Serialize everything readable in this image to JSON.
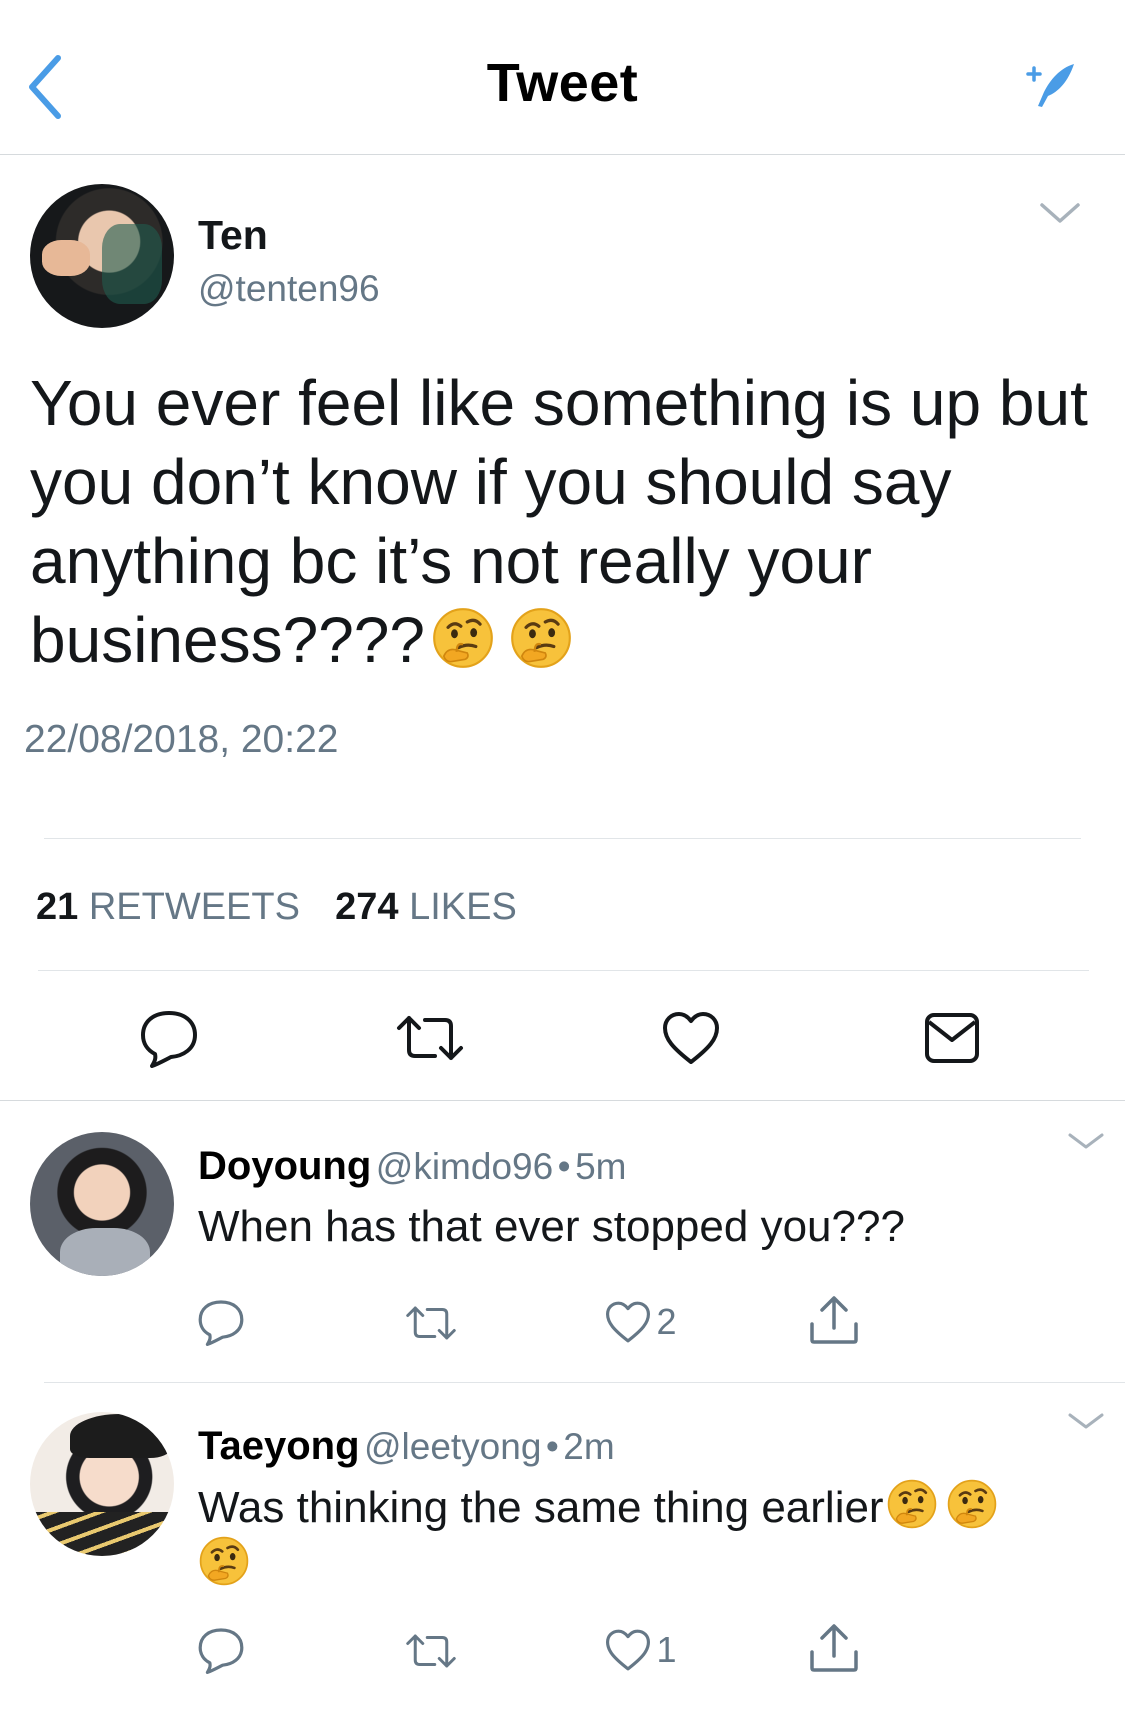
{
  "header": {
    "title": "Tweet",
    "back_icon": "chevron-left-icon",
    "compose_icon": "compose-feather-icon",
    "accent_color": "#4a9ce6"
  },
  "tweet": {
    "author_name": "Ten",
    "author_handle": "@tenten96",
    "text": "You ever feel like something is up but you don’t know if you should say anything bc it’s not really your business????",
    "emojis": [
      "thinking-face-emoji",
      "thinking-face-emoji"
    ],
    "timestamp": "22/08/2018, 20:22",
    "retweets_count": "21",
    "retweets_label": "RETWEETS",
    "likes_count": "274",
    "likes_label": "LIKES",
    "actions": [
      "reply-icon",
      "retweet-icon",
      "heart-icon",
      "mail-icon"
    ]
  },
  "replies": [
    {
      "name": "Doyoung",
      "handle": "@kimdo96",
      "separator": "•",
      "time": "5m",
      "text": "When has that ever stopped you???",
      "likes": "2"
    },
    {
      "name": "Taeyong",
      "handle": "@leetyong",
      "separator": "•",
      "time": "2m",
      "text": "Was thinking the same thing earlier",
      "emojis": [
        "thinking-face-emoji",
        "thinking-face-emoji",
        "thinking-face-emoji"
      ],
      "likes": "1"
    }
  ]
}
